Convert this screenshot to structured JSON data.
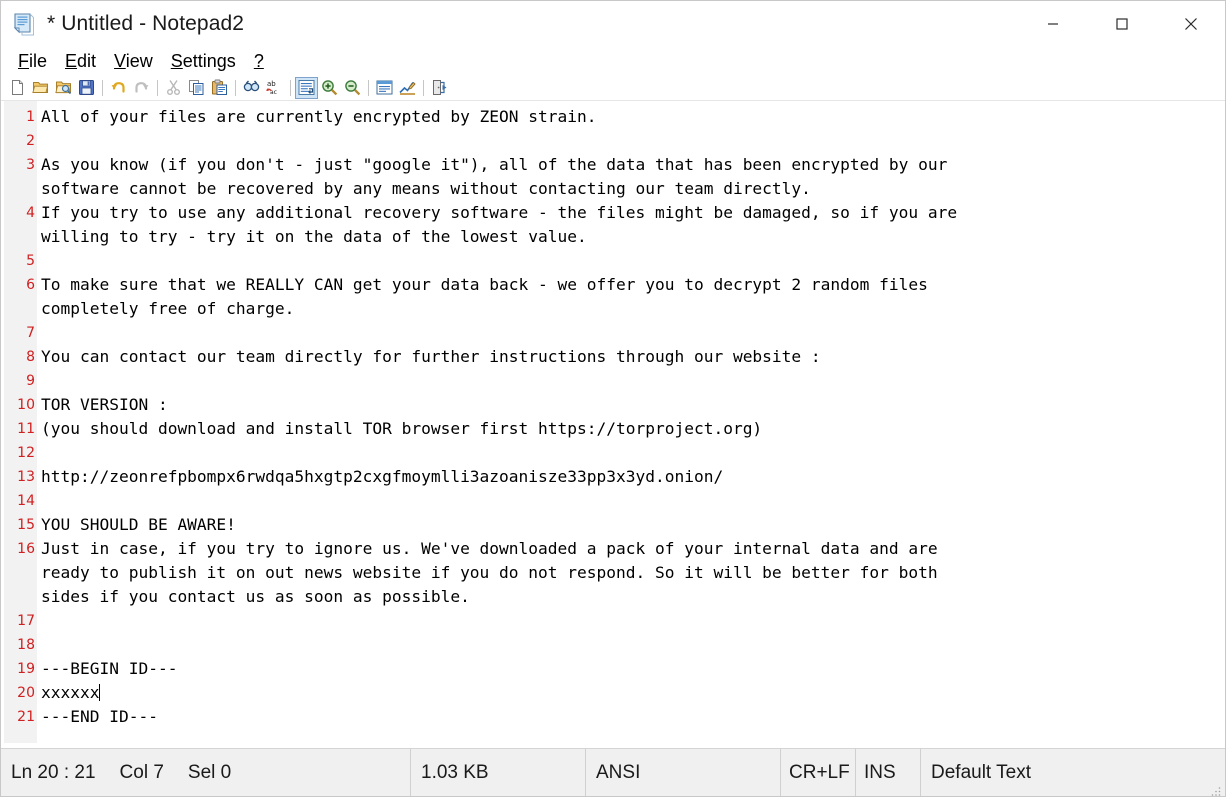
{
  "window": {
    "title": "* Untitled - Notepad2",
    "app_icon": "notepad-document-icon",
    "minimize_label": "Minimize",
    "maximize_label": "Maximize",
    "close_label": "Close"
  },
  "menubar": {
    "items": [
      {
        "accel": "F",
        "rest": "ile",
        "name": "menu-file"
      },
      {
        "accel": "E",
        "rest": "dit",
        "name": "menu-edit"
      },
      {
        "accel": "V",
        "rest": "iew",
        "name": "menu-view"
      },
      {
        "accel": "S",
        "rest": "ettings",
        "name": "menu-settings"
      },
      {
        "accel": "?",
        "rest": "",
        "name": "menu-help"
      }
    ]
  },
  "toolbar": {
    "buttons": [
      {
        "name": "new-file-icon",
        "tip": "New"
      },
      {
        "name": "open-file-icon",
        "tip": "Open"
      },
      {
        "name": "browse-file-icon",
        "tip": "Browse"
      },
      {
        "name": "save-file-icon",
        "tip": "Save"
      },
      {
        "name": "separator",
        "tip": ""
      },
      {
        "name": "undo-icon",
        "tip": "Undo"
      },
      {
        "name": "redo-icon",
        "tip": "Redo"
      },
      {
        "name": "separator",
        "tip": ""
      },
      {
        "name": "cut-icon",
        "tip": "Cut"
      },
      {
        "name": "copy-icon",
        "tip": "Copy"
      },
      {
        "name": "paste-icon",
        "tip": "Paste"
      },
      {
        "name": "separator",
        "tip": ""
      },
      {
        "name": "find-icon",
        "tip": "Find"
      },
      {
        "name": "replace-icon",
        "tip": "Replace"
      },
      {
        "name": "separator",
        "tip": ""
      },
      {
        "name": "word-wrap-icon",
        "tip": "Word Wrap",
        "active": true
      },
      {
        "name": "zoom-in-icon",
        "tip": "Zoom In"
      },
      {
        "name": "zoom-out-icon",
        "tip": "Zoom Out"
      },
      {
        "name": "separator",
        "tip": ""
      },
      {
        "name": "scheme-icon",
        "tip": "Scheme"
      },
      {
        "name": "scheme-options-icon",
        "tip": "Scheme Options"
      },
      {
        "name": "separator",
        "tip": ""
      },
      {
        "name": "exit-icon",
        "tip": "Exit"
      }
    ]
  },
  "editor": {
    "cursor_line": 20,
    "lines": [
      {
        "n": 1,
        "text": "All of your files are currently encrypted by ZEON strain."
      },
      {
        "n": 2,
        "text": ""
      },
      {
        "n": 3,
        "text": "As you know (if you don't - just \"google it\"), all of the data that has been encrypted by our"
      },
      {
        "n": "",
        "text": "software cannot be recovered by any means without contacting our team directly."
      },
      {
        "n": 4,
        "text": "If you try to use any additional recovery software - the files might be damaged, so if you are"
      },
      {
        "n": "",
        "text": "willing to try - try it on the data of the lowest value."
      },
      {
        "n": 5,
        "text": ""
      },
      {
        "n": 6,
        "text": "To make sure that we REALLY CAN get your data back - we offer you to decrypt 2 random files"
      },
      {
        "n": "",
        "text": "completely free of charge."
      },
      {
        "n": 7,
        "text": ""
      },
      {
        "n": 8,
        "text": "You can contact our team directly for further instructions through our website :"
      },
      {
        "n": 9,
        "text": ""
      },
      {
        "n": 10,
        "text": "TOR VERSION :"
      },
      {
        "n": 11,
        "text": "(you should download and install TOR browser first https://torproject.org)"
      },
      {
        "n": 12,
        "text": ""
      },
      {
        "n": 13,
        "text": "http://zeonrefpbompx6rwdqa5hxgtp2cxgfmoymlli3azoanisze33pp3x3yd.onion/"
      },
      {
        "n": 14,
        "text": ""
      },
      {
        "n": 15,
        "text": "YOU SHOULD BE AWARE!"
      },
      {
        "n": 16,
        "text": "Just in case, if you try to ignore us. We've downloaded a pack of your internal data and are"
      },
      {
        "n": "",
        "text": "ready to publish it on out news website if you do not respond. So it will be better for both"
      },
      {
        "n": "",
        "text": "sides if you contact us as soon as possible."
      },
      {
        "n": 17,
        "text": ""
      },
      {
        "n": 18,
        "text": ""
      },
      {
        "n": 19,
        "text": "---BEGIN ID---"
      },
      {
        "n": 20,
        "text": "xxxxxx",
        "cursor": true
      },
      {
        "n": 21,
        "text": "---END ID---"
      }
    ]
  },
  "statusbar": {
    "line_col": "Ln 20 : 21",
    "col": "Col 7",
    "sel": "Sel 0",
    "file_size": "1.03 KB",
    "encoding": "ANSI",
    "eol": "CR+LF",
    "insert_mode": "INS",
    "scheme": "Default Text"
  },
  "colors": {
    "line_number": "#d02020",
    "gutter_bg": "#f2f2f2",
    "editor_bg": "#ffffff",
    "statusbar_bg": "#f0f0f0",
    "text": "#000000"
  }
}
